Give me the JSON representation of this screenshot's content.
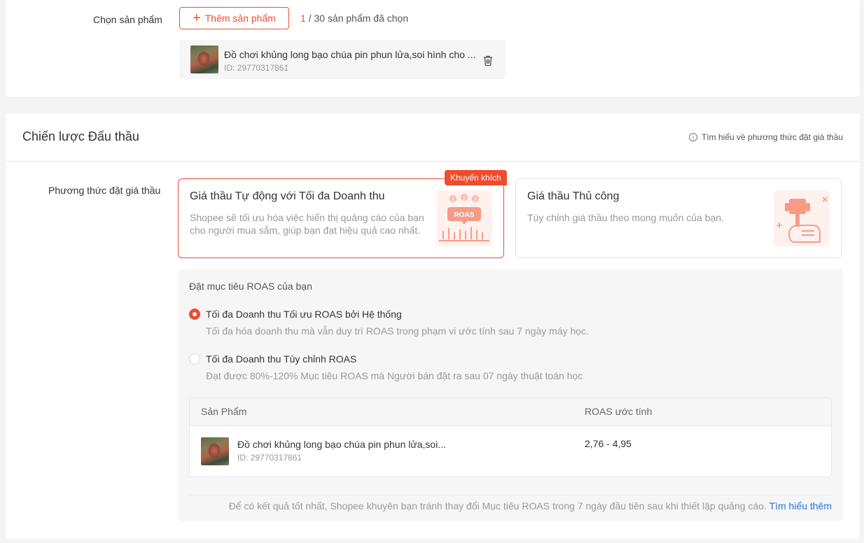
{
  "product_section": {
    "label": "Chọn sản phẩm",
    "add_button": "Thêm sản phẩm",
    "selected_count": "1",
    "selected_suffix": "/ 30 sản phẩm đã chọn",
    "product": {
      "name": "Đồ chơi khủng long bạo chúa pin phun lửa,soi hình cho ...",
      "id": "ID: 29770317861"
    }
  },
  "bidding": {
    "title": "Chiến lược Đấu thầu",
    "learn_link": "Tìm hiểu về phương thức đặt giá thầu",
    "method_label": "Phương thức đặt giá thầu",
    "auto": {
      "badge": "Khuyến khích",
      "title": "Giá thầu Tự động với Tối đa Doanh thu",
      "desc": "Shopee sẽ tối ưu hóa việc hiển thị quảng cáo của bạn cho người mua sắm, giúp bạn đạt hiệu quả cao nhất.",
      "illustration_text": "ROAS"
    },
    "manual": {
      "title": "Giá thầu Thủ công",
      "desc": "Tùy chỉnh giá thầu theo mong muốn của bạn."
    }
  },
  "roas": {
    "title": "Đặt mục tiêu ROAS của bạn",
    "options": [
      {
        "label": "Tối đa Doanh thu Tối ưu ROAS bởi Hệ thống",
        "desc": "Tối đa hóa doanh thu mà vẫn duy trì ROAS trong phạm vi ước tính sau 7 ngày máy học.",
        "selected": true
      },
      {
        "label": "Tối đa Doanh thu Tùy chỉnh ROAS",
        "desc": "Đạt được 80%-120% Mục tiêu ROAS mà Người bán đặt ra sau 07 ngày thuật toán học",
        "selected": false
      }
    ],
    "table": {
      "headers": [
        "Sản Phẩm",
        "ROAS ước tính"
      ],
      "rows": [
        {
          "name": "Đồ chơi khủng long bạo chúa pin phun lửa,soi...",
          "id": "ID: 29770317861",
          "roas": "2,76 - 4,95"
        }
      ]
    },
    "footer_note": "Để có kết quả tốt nhất, Shopee khuyên bạn tránh thay đổi Mục tiêu ROAS trong 7 ngày đầu tiên sau khi thiết lập quảng cáo.",
    "footer_link": "Tìm hiểu thêm"
  },
  "colors": {
    "accent": "#ee4d2d",
    "link": "#2673dd"
  }
}
